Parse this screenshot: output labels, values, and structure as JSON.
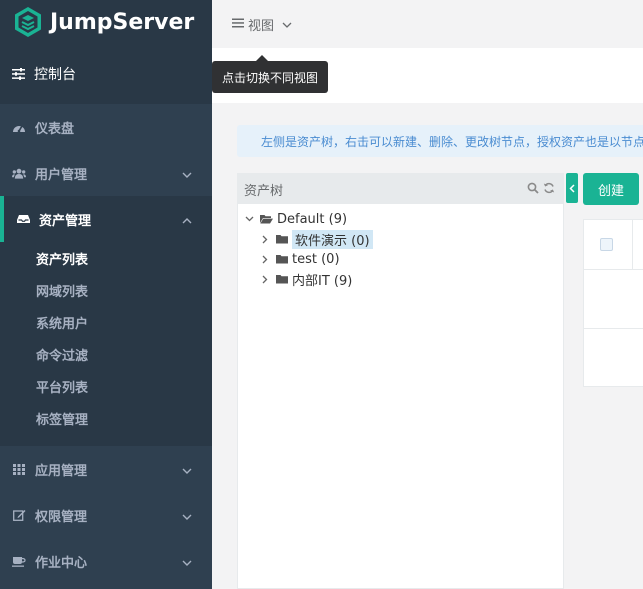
{
  "app": {
    "logo_text": "JumpServer"
  },
  "sidebar": {
    "console_label": "控制台",
    "items": [
      {
        "label": "仪表盘",
        "icon": "dashboard-icon"
      },
      {
        "label": "用户管理",
        "icon": "users-icon"
      },
      {
        "label": "资产管理",
        "icon": "inbox-icon",
        "active": true
      },
      {
        "label": "应用管理",
        "icon": "grid-icon"
      },
      {
        "label": "权限管理",
        "icon": "edit-icon"
      },
      {
        "label": "作业中心",
        "icon": "coffee-icon"
      }
    ],
    "asset_submenu": [
      {
        "label": "资产列表",
        "current": true
      },
      {
        "label": "网域列表"
      },
      {
        "label": "系统用户"
      },
      {
        "label": "命令过滤"
      },
      {
        "label": "平台列表"
      },
      {
        "label": "标签管理"
      }
    ]
  },
  "topbar": {
    "view_label": "视图",
    "tooltip": "点击切换不同视图"
  },
  "alert": {
    "text": "左侧是资产树，右击可以新建、删除、更改树节点，授权资产也是以节点"
  },
  "tree": {
    "title": "资产树",
    "root": {
      "label": "Default (9)"
    },
    "children": [
      {
        "label": "软件演示 (0)",
        "highlight": true
      },
      {
        "label": "test (0)"
      },
      {
        "label": "内部IT (9)"
      }
    ]
  },
  "toolbar": {
    "create_label": "创建"
  },
  "colors": {
    "sidebar": "#2f4050",
    "accent": "#1ab394",
    "alert_bg": "#e6f1fa",
    "alert_text": "#4a8cd1"
  }
}
